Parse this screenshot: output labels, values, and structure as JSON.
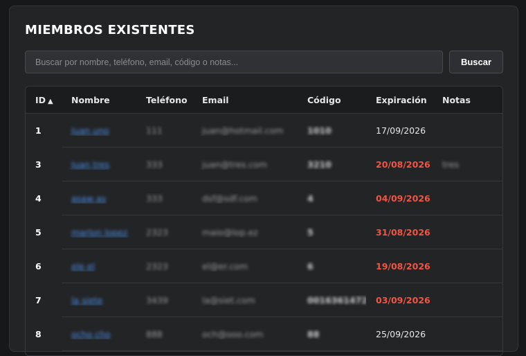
{
  "title": "MIEMBROS EXISTENTES",
  "search": {
    "placeholder": "Buscar por nombre, teléfono, email, código o notas...",
    "value": "",
    "button_label": "Buscar"
  },
  "table": {
    "columns": {
      "id": "ID",
      "sort_indicator": "▲",
      "nombre": "Nombre",
      "telefono": "Teléfono",
      "email": "Email",
      "codigo": "Código",
      "expiracion": "Expiración",
      "notas": "Notas"
    },
    "rows": [
      {
        "id": "1",
        "nombre": "Juan uno",
        "telefono": "111",
        "email": "juan@hotmail.com",
        "codigo": "1010",
        "expiracion": "17/09/2026",
        "expired": false,
        "notas": ""
      },
      {
        "id": "3",
        "nombre": "Juan tres",
        "telefono": "333",
        "email": "juan@tres.com",
        "codigo": "3210",
        "expiracion": "20/08/2026",
        "expired": true,
        "notas": "tres"
      },
      {
        "id": "4",
        "nombre": "asaw as",
        "telefono": "333",
        "email": "dsf@sdf.com",
        "codigo": "4",
        "expiracion": "04/09/2026",
        "expired": true,
        "notas": ""
      },
      {
        "id": "5",
        "nombre": "marlon lopez",
        "telefono": "2323",
        "email": "maio@lop.ez",
        "codigo": "5",
        "expiracion": "31/08/2026",
        "expired": true,
        "notas": ""
      },
      {
        "id": "6",
        "nombre": "ele el",
        "telefono": "2323",
        "email": "el@er.com",
        "codigo": "6",
        "expiracion": "19/08/2026",
        "expired": true,
        "notas": ""
      },
      {
        "id": "7",
        "nombre": "la siete",
        "telefono": "3439",
        "email": "la@siet.com",
        "codigo": "0016361472",
        "expiracion": "03/09/2026",
        "expired": true,
        "notas": ""
      },
      {
        "id": "8",
        "nombre": "ocho cho",
        "telefono": "888",
        "email": "och@ooo.com",
        "codigo": "88",
        "expiracion": "25/09/2026",
        "expired": false,
        "notas": ""
      }
    ]
  },
  "colors": {
    "expired": "#f05545",
    "link": "#4a8fe6",
    "background": "#17181a",
    "panel": "#232426"
  }
}
